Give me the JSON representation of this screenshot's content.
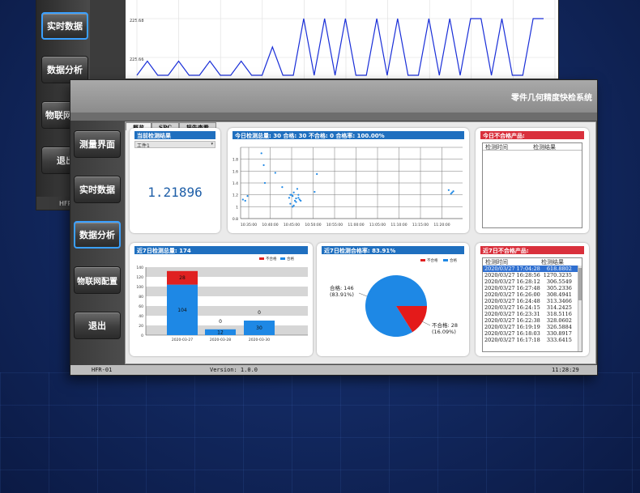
{
  "back_window": {
    "y_ticks": [
      "225.68",
      "225.66",
      "225.64"
    ],
    "nav": [
      {
        "label": "实时数据",
        "active": true
      },
      {
        "label": "数据分析",
        "active": false
      },
      {
        "label": "物联网",
        "active": false
      },
      {
        "label": "退出",
        "active": false
      }
    ],
    "status_left": "HFR"
  },
  "app": {
    "title": "零件几何精度快检系统",
    "version": "Version: 1.0.0",
    "device": "HFR-01",
    "clock": "11:28:29"
  },
  "nav": [
    {
      "label": "测量界面",
      "active": false
    },
    {
      "label": "实时数据",
      "active": false
    },
    {
      "label": "数据分析",
      "active": true
    },
    {
      "label": "物联网配置",
      "active": false
    },
    {
      "label": "退出",
      "active": false
    }
  ],
  "tabs": [
    "概览",
    "SPC",
    "报告查看"
  ],
  "current_result": {
    "header": "当前检测结果",
    "part_select": "工件1",
    "value": "1.21896"
  },
  "today_panel": {
    "header": "今日检测总量: 30   合格: 30   不合格: 0   合格率: 100.00%"
  },
  "today_fail": {
    "header": "今日不合格产品:",
    "col_time": "检测时间",
    "col_result": "检测结果"
  },
  "week_total": {
    "header": "近7日检测总量: 174",
    "legend_fail": "不合格",
    "legend_pass": "合格"
  },
  "week_rate": {
    "header": "近7日检测合格率: 83.91%",
    "legend_fail": "不合格",
    "legend_pass": "合格",
    "label_pass": "合格: 146",
    "label_pass_pct": "(83.91%)",
    "label_fail": "不合格: 28",
    "label_fail_pct": "(16.09%)"
  },
  "week_fail": {
    "header": "近7日不合格产品:",
    "col_time": "检测时间",
    "col_result": "检测结果",
    "rows": [
      {
        "time": "2020/03/27 17:04:28",
        "value": "618.8802",
        "selected": true
      },
      {
        "time": "2020/03/27 16:28:56",
        "value": "1270.3235",
        "selected": false
      },
      {
        "time": "2020/03/27 16:28:12",
        "value": "306.5549",
        "selected": false
      },
      {
        "time": "2020/03/27 16:27:48",
        "value": "305.2336",
        "selected": false
      },
      {
        "time": "2020/03/27 16:26:00",
        "value": "308.4941",
        "selected": false
      },
      {
        "time": "2020/03/27 16:24:48",
        "value": "313.3466",
        "selected": false
      },
      {
        "time": "2020/03/27 16:24:15",
        "value": "314.2425",
        "selected": false
      },
      {
        "time": "2020/03/27 16:23:31",
        "value": "318.5116",
        "selected": false
      },
      {
        "time": "2020/03/27 16:22:38",
        "value": "328.0602",
        "selected": false
      },
      {
        "time": "2020/03/27 16:19:19",
        "value": "326.5884",
        "selected": false
      },
      {
        "time": "2020/03/27 16:18:03",
        "value": "330.8917",
        "selected": false
      },
      {
        "time": "2020/03/27 16:17:18",
        "value": "333.6415",
        "selected": false
      }
    ]
  },
  "chart_data": [
    {
      "type": "line",
      "panel": "back-window realtime",
      "ylim": [
        225.64,
        225.68
      ],
      "y_ticks": [
        225.68,
        225.66
      ],
      "values": [
        225.64,
        225.65,
        225.64,
        225.64,
        225.65,
        225.64,
        225.64,
        225.65,
        225.64,
        225.64,
        225.65,
        225.64,
        225.64,
        225.66,
        225.64,
        225.64,
        225.68,
        225.64,
        225.68,
        225.64,
        225.68,
        225.64,
        225.64,
        225.68,
        225.64,
        225.68,
        225.64,
        225.64,
        225.68,
        225.64,
        225.68,
        225.64,
        225.68,
        225.68,
        225.64,
        225.68,
        225.64,
        225.64,
        225.68,
        225.68
      ]
    },
    {
      "type": "scatter",
      "panel": "today",
      "ylim": [
        0.8,
        2.0
      ],
      "y_ticks": [
        "1.8",
        "1.6",
        "1.4",
        "1.2",
        "1",
        "0.8"
      ],
      "x_ticks": [
        "10:35:00",
        "10:40:00",
        "10:45:00",
        "10:50:00",
        "10:55:00",
        "11:00:00",
        "11:05:00",
        "11:10:00",
        "11:15:00",
        "11:20:00"
      ],
      "xlim": [
        0,
        9.6
      ],
      "points": [
        [
          0.1,
          1.12
        ],
        [
          0.2,
          1.1
        ],
        [
          0.3,
          1.18
        ],
        [
          0.9,
          1.9
        ],
        [
          1.0,
          1.7
        ],
        [
          1.05,
          1.4
        ],
        [
          1.5,
          1.57
        ],
        [
          1.8,
          1.33
        ],
        [
          2.1,
          1.15
        ],
        [
          2.15,
          1.2
        ],
        [
          2.2,
          1.2
        ],
        [
          2.25,
          1.18
        ],
        [
          2.3,
          1.24
        ],
        [
          2.35,
          1.1
        ],
        [
          2.4,
          1.14
        ],
        [
          2.45,
          1.3
        ],
        [
          2.5,
          1.2
        ],
        [
          2.55,
          1.12
        ],
        [
          2.6,
          1.1
        ],
        [
          2.15,
          1.05
        ],
        [
          2.25,
          1.0
        ],
        [
          2.3,
          1.02
        ],
        [
          2.4,
          1.08
        ],
        [
          2.5,
          1.15
        ],
        [
          3.2,
          1.25
        ],
        [
          3.3,
          1.55
        ],
        [
          9.0,
          1.28
        ],
        [
          9.1,
          1.22
        ],
        [
          9.15,
          1.24
        ],
        [
          9.2,
          1.26
        ]
      ]
    },
    {
      "type": "bar",
      "panel": "week_total",
      "categories": [
        "2020-03-27",
        "2020-03-28",
        "2020-03-30"
      ],
      "series": [
        {
          "name": "合格",
          "values": [
            104,
            12,
            30
          ]
        },
        {
          "name": "不合格",
          "values": [
            28,
            0,
            0
          ]
        }
      ],
      "ylim": [
        0,
        140
      ],
      "y_ticks": [
        0,
        20,
        40,
        60,
        80,
        100,
        120,
        140
      ]
    },
    {
      "type": "pie",
      "panel": "week_rate",
      "slices": [
        {
          "name": "合格",
          "value": 146,
          "pct": 83.91
        },
        {
          "name": "不合格",
          "value": 28,
          "pct": 16.09
        }
      ]
    }
  ]
}
